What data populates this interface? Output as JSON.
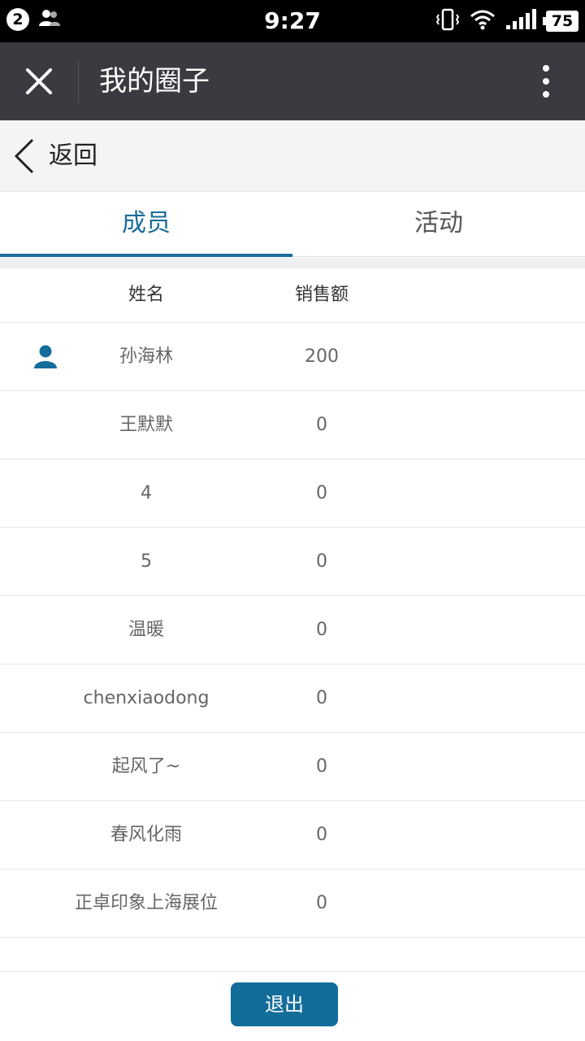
{
  "status_bar": {
    "notification_count": "2",
    "time": "9:27",
    "battery": "75",
    "icons": [
      "contacts-icon",
      "vibrate-icon",
      "wifi-icon",
      "signal-icon",
      "battery-icon"
    ]
  },
  "title_bar": {
    "title": "我的圈子"
  },
  "back_bar": {
    "label": "返回"
  },
  "tabs": [
    {
      "label": "成员",
      "active": true
    },
    {
      "label": "活动",
      "active": false
    }
  ],
  "table": {
    "headers": {
      "name": "姓名",
      "sales": "销售额"
    },
    "rows": [
      {
        "name": "孙海林",
        "sales": "200",
        "has_icon": true
      },
      {
        "name": "王默默",
        "sales": "0"
      },
      {
        "name": "4",
        "sales": "0"
      },
      {
        "name": "5",
        "sales": "0"
      },
      {
        "name": "温暖",
        "sales": "0"
      },
      {
        "name": "chenxiaodong",
        "sales": "0"
      },
      {
        "name": "起风了~",
        "sales": "0"
      },
      {
        "name": "春风化雨",
        "sales": "0"
      },
      {
        "name": "正卓印象上海展位",
        "sales": "0"
      }
    ]
  },
  "footer": {
    "exit_label": "退出"
  },
  "colors": {
    "accent": "#136d9a",
    "title_bar_bg": "#393b40",
    "back_bar_bg": "#f3f5f5"
  }
}
